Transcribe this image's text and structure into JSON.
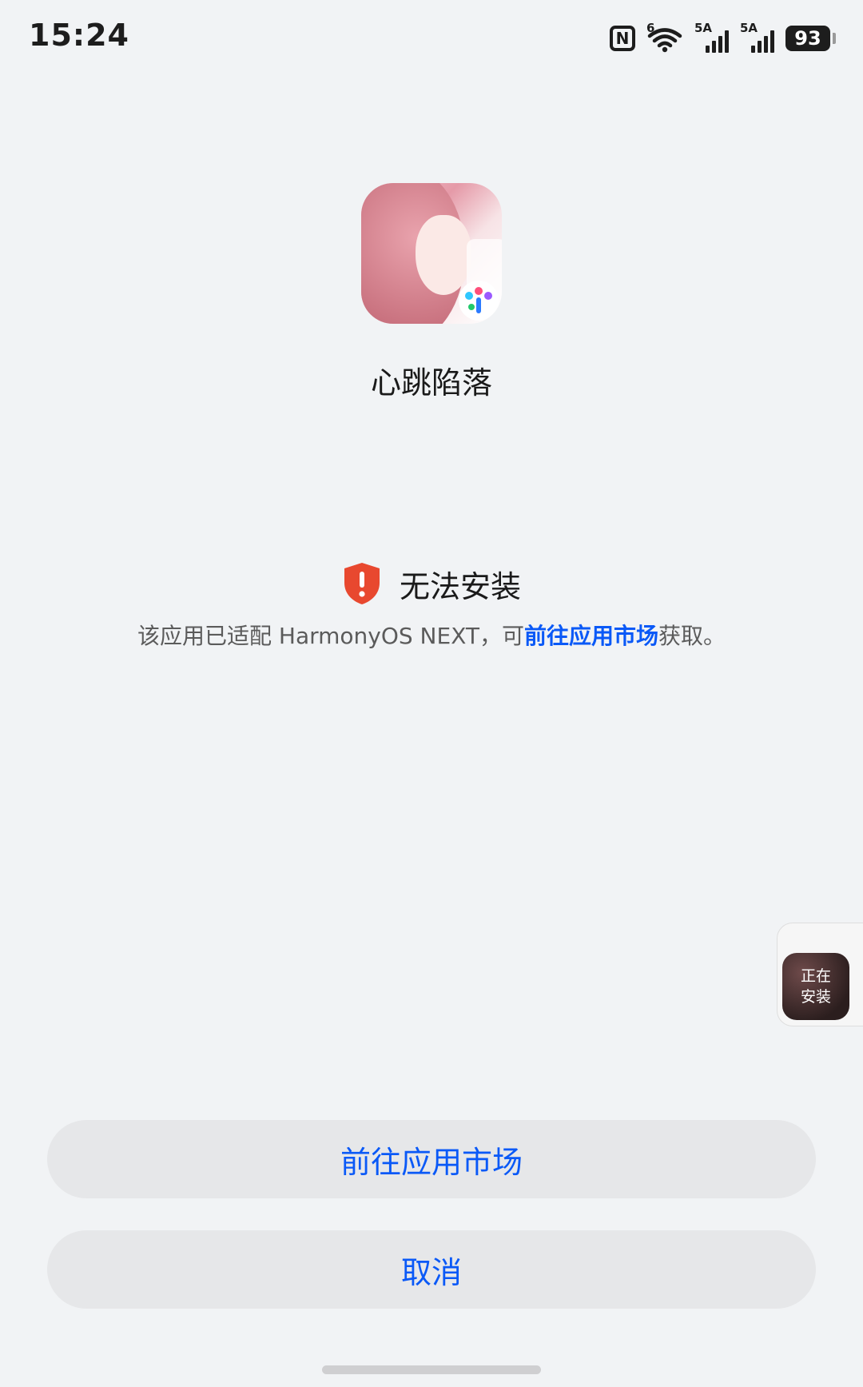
{
  "status_bar": {
    "time": "15:24",
    "nfc_label": "N",
    "wifi_tag": "6",
    "sim1_tag": "5A",
    "sim2_tag": "5A",
    "battery_level": "93",
    "icons": [
      "nfc-icon",
      "wifi-6-icon",
      "signal-5a-icon",
      "signal-5a-icon",
      "battery-icon"
    ]
  },
  "app": {
    "name": "心跳陷落",
    "icon": "app-icon-anime-portrait"
  },
  "warning": {
    "icon": "shield-alert-icon",
    "icon_color": "#e8482f",
    "title": "无法安装",
    "desc_prefix": "该应用已适配 HarmonyOS NEXT，可",
    "desc_link": "前往应用市场",
    "desc_suffix": "获取。"
  },
  "floating": {
    "line1": "正在",
    "line2": "安装"
  },
  "buttons": {
    "market": "前往应用市场",
    "cancel": "取消"
  },
  "colors": {
    "accent": "#0a59f7",
    "background": "#f1f3f5",
    "button_bg": "#e6e7e9"
  }
}
